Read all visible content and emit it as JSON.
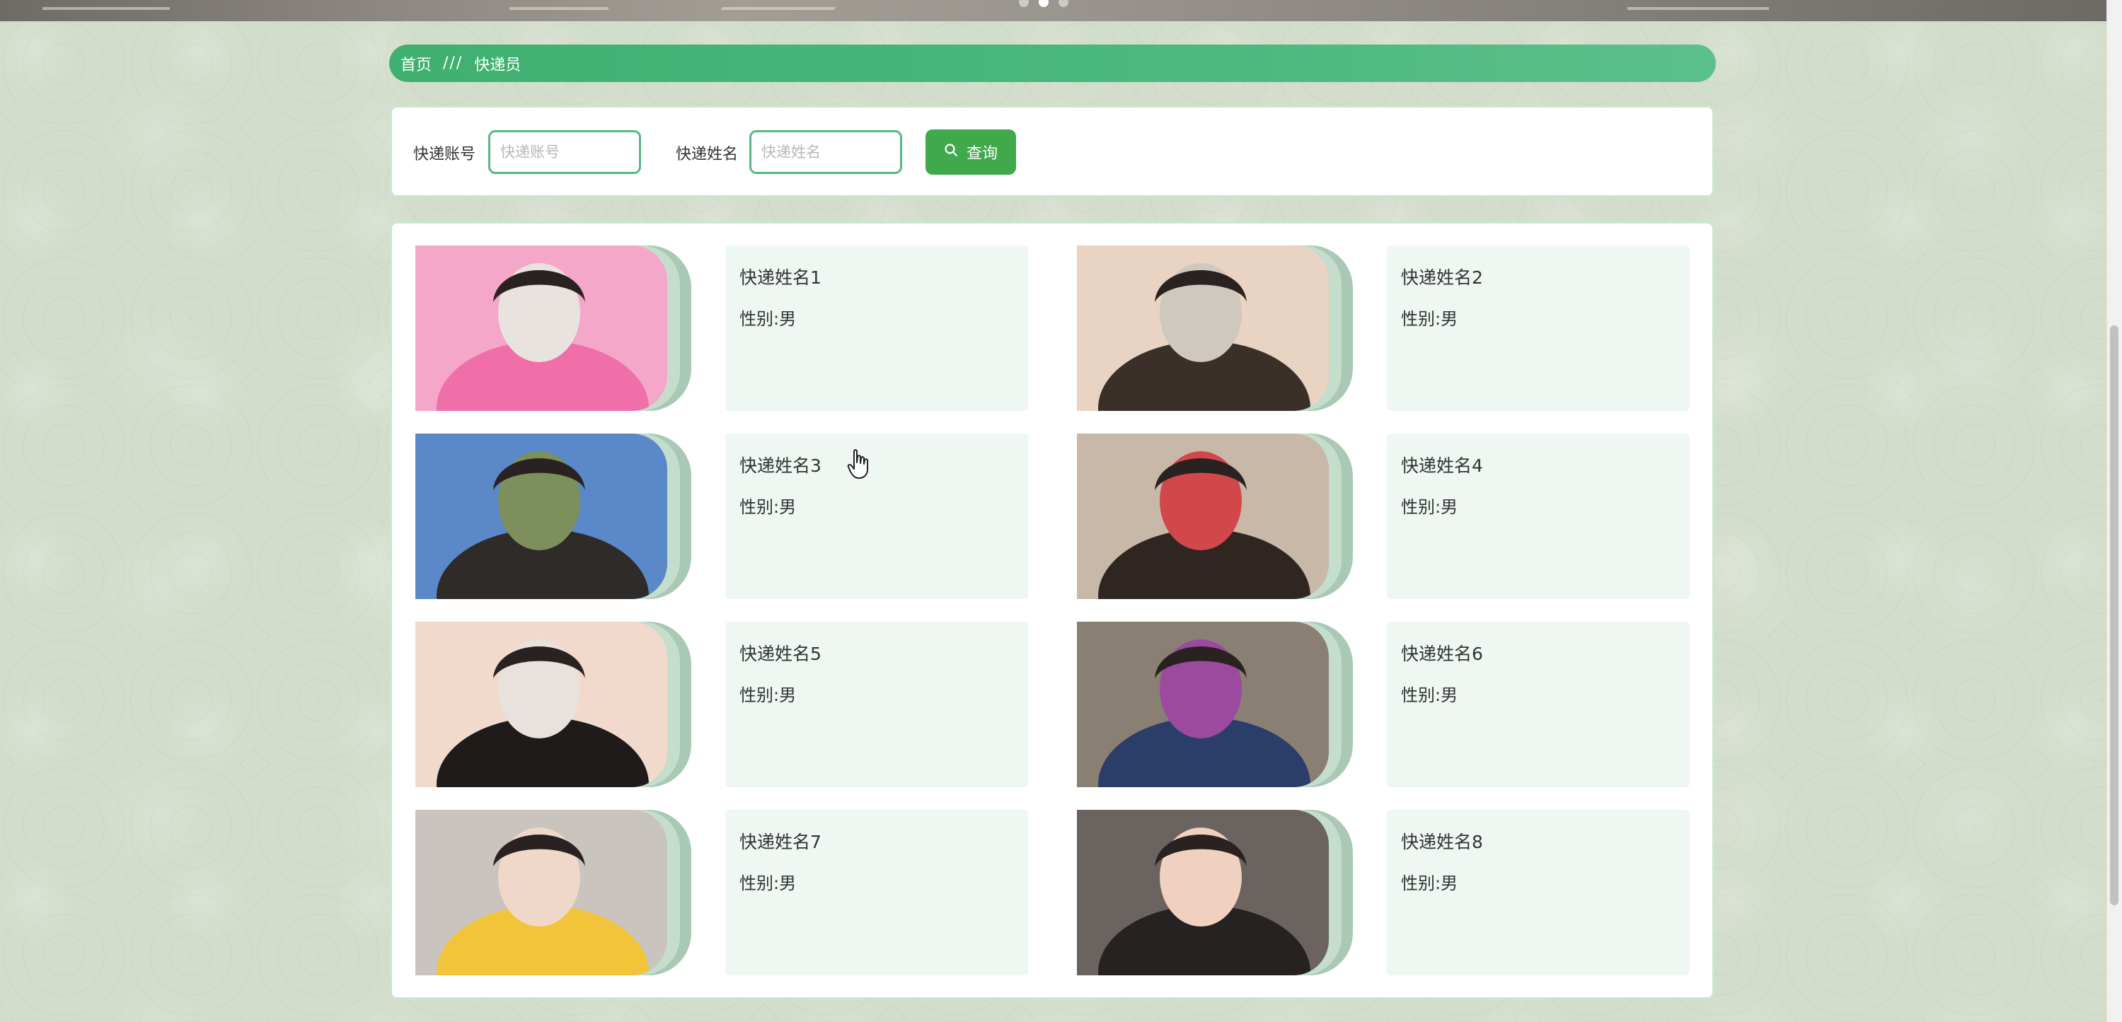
{
  "breadcrumb": {
    "home": "首页",
    "separator": "///",
    "current": "快递员"
  },
  "search": {
    "account_label": "快递账号",
    "account_placeholder": "快递账号",
    "account_value": "",
    "name_label": "快递姓名",
    "name_placeholder": "快递姓名",
    "name_value": "",
    "button_label": "查询",
    "button_icon": "search-icon"
  },
  "couriers": [
    {
      "name": "快递姓名1",
      "gender": "性别:男",
      "photo_tones": [
        "#f4a7c9",
        "#f06fa8",
        "#e9e3df"
      ]
    },
    {
      "name": "快递姓名2",
      "gender": "性别:男",
      "photo_tones": [
        "#e9d3c2",
        "#3b3029",
        "#cfc8bf"
      ]
    },
    {
      "name": "快递姓名3",
      "gender": "性别:男",
      "photo_tones": [
        "#5a88c8",
        "#2e2b29",
        "#7d8f5a"
      ]
    },
    {
      "name": "快递姓名4",
      "gender": "性别:男",
      "photo_tones": [
        "#c7b8a8",
        "#2f2622",
        "#d2474a"
      ]
    },
    {
      "name": "快递姓名5",
      "gender": "性别:男",
      "photo_tones": [
        "#f1d9cc",
        "#1f1b1b",
        "#e8e1dc"
      ]
    },
    {
      "name": "快递姓名6",
      "gender": "性别:男",
      "photo_tones": [
        "#8a7f73",
        "#2b3e6a",
        "#9b4aa0"
      ]
    },
    {
      "name": "快递姓名7",
      "gender": "性别:男",
      "photo_tones": [
        "#c9c4bd",
        "#f2c43a",
        "#efd8c8"
      ]
    },
    {
      "name": "快递姓名8",
      "gender": "性别:男",
      "photo_tones": [
        "#6a6360",
        "#262221",
        "#f0d1c0"
      ]
    }
  ],
  "colors": {
    "accent_green": "#3fa94c",
    "breadcrumb_green": "#4cb87d",
    "info_bg": "#eef7f1",
    "panel_border": "#c9e6d3"
  }
}
